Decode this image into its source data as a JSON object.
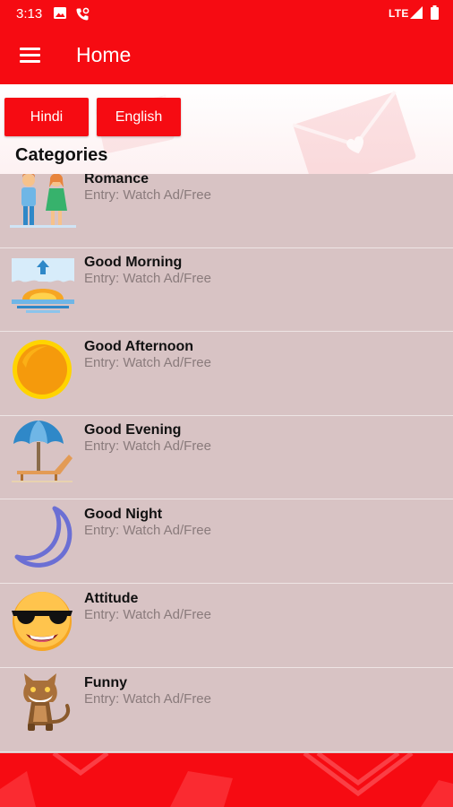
{
  "status_bar": {
    "time": "3:13",
    "network": "LTE"
  },
  "app_bar": {
    "title": "Home"
  },
  "language_buttons": {
    "hindi": "Hindi",
    "english": "English"
  },
  "categories_heading": "Categories",
  "categories": [
    {
      "name": "Romance",
      "entry": "Entry: Watch Ad/Free",
      "icon": "couple-icon"
    },
    {
      "name": "Good Morning",
      "entry": "Entry: Watch Ad/Free",
      "icon": "sunrise-icon"
    },
    {
      "name": "Good Afternoon",
      "entry": "Entry: Watch Ad/Free",
      "icon": "sun-icon"
    },
    {
      "name": "Good Evening",
      "entry": "Entry: Watch Ad/Free",
      "icon": "beach-umbrella-icon"
    },
    {
      "name": "Good Night",
      "entry": "Entry: Watch Ad/Free",
      "icon": "crescent-moon-icon"
    },
    {
      "name": "Attitude",
      "entry": "Entry: Watch Ad/Free",
      "icon": "sunglasses-face-icon"
    },
    {
      "name": "Funny",
      "entry": "Entry: Watch Ad/Free",
      "icon": "funny-cat-icon"
    }
  ],
  "colors": {
    "primary": "#f60b12",
    "list_background": "#d8c3c4",
    "subtitle": "#8a7b7c"
  }
}
